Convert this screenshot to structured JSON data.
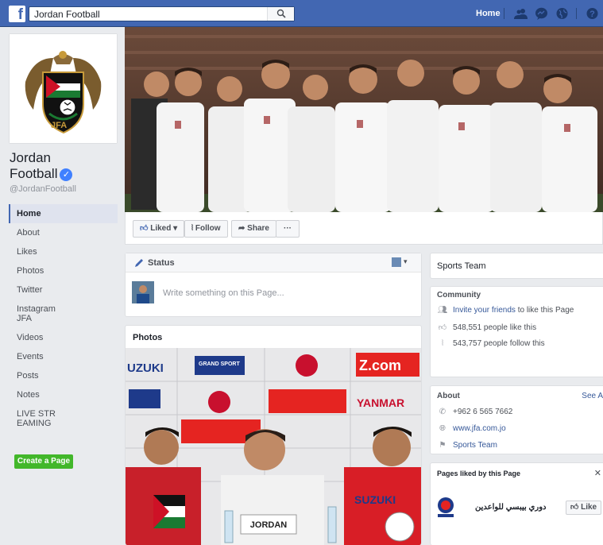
{
  "topbar": {
    "logo": "f",
    "search_value": "Jordan Football",
    "home_label": "Home"
  },
  "profile": {
    "logo_text": "JFA",
    "name_line1": "Jordan",
    "name_line2": "Football",
    "handle": "@JordanFootball"
  },
  "nav": {
    "items": [
      "Home",
      "About",
      "Likes",
      "Photos",
      "Twitter",
      "Instagram JFA",
      "Videos",
      "Events",
      "Posts",
      "Notes",
      "LIVE STREAMING"
    ],
    "create_page": "Create a Page"
  },
  "actions": {
    "liked": "Liked",
    "follow": "Follow",
    "share": "Share",
    "more": "···"
  },
  "composer": {
    "status_label": "Status",
    "placeholder": "Write something on this Page..."
  },
  "photos": {
    "title": "Photos",
    "sponsors": [
      "UZUKI",
      "GRAND SPORT",
      "Z.com",
      "YANMAR",
      "SUZUKI"
    ],
    "nameplate": "JORDAN"
  },
  "sidebar": {
    "category": "Sports Team",
    "community": {
      "title": "Community",
      "invite_link": "Invite your friends",
      "invite_rest": "to like this Page",
      "likes": "548,551 people like this",
      "follows": "543,757 people follow this"
    },
    "about": {
      "title": "About",
      "see_all": "See A",
      "phone": "+962 6 565 7662",
      "website": "www.jfa.com.jo",
      "category": "Sports Team"
    },
    "pages_liked": {
      "title": "Pages liked by this Page",
      "page_name": "دوري بيبسي للواعدين",
      "like_label": "Like"
    }
  },
  "colors": {
    "brand": "#4267b2",
    "green": "#42b72a",
    "link": "#365899"
  }
}
